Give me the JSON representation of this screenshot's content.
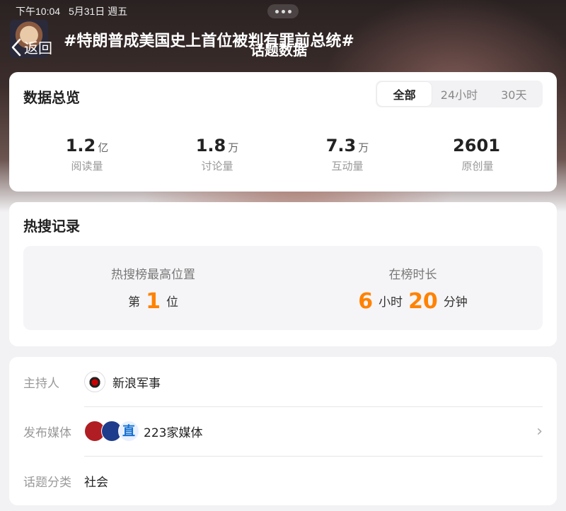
{
  "status_bar": {
    "time": "下午10:04",
    "date": "5月31日 週五"
  },
  "header": {
    "back_label": "返回",
    "topic": "#特朗普成美国史上首位被判有罪前总统#",
    "page_title": "话题数据"
  },
  "overview": {
    "title": "数据总览",
    "tabs": [
      "全部",
      "24小时",
      "30天"
    ],
    "active_tab": "全部",
    "stats": [
      {
        "value": "1.2",
        "unit": "亿",
        "label": "阅读量"
      },
      {
        "value": "1.8",
        "unit": "万",
        "label": "讨论量"
      },
      {
        "value": "7.3",
        "unit": "万",
        "label": "互动量"
      },
      {
        "value": "2601",
        "unit": "",
        "label": "原创量"
      }
    ]
  },
  "hot_search": {
    "title": "热搜记录",
    "peak_label": "热搜榜最高位置",
    "peak_prefix": "第",
    "peak_value": "1",
    "peak_suffix": "位",
    "duration_label": "在榜时长",
    "hours": "6",
    "hours_unit": "小时",
    "minutes": "20",
    "minutes_unit": "分钟"
  },
  "info": {
    "host_key": "主持人",
    "host_name": "新浪军事",
    "media_key": "发布媒体",
    "media_value": "223家媒体",
    "category_key": "话题分类",
    "category_value": "社会"
  },
  "colors": {
    "accent": "#ff8200",
    "hero_dark": "#2a2222"
  }
}
